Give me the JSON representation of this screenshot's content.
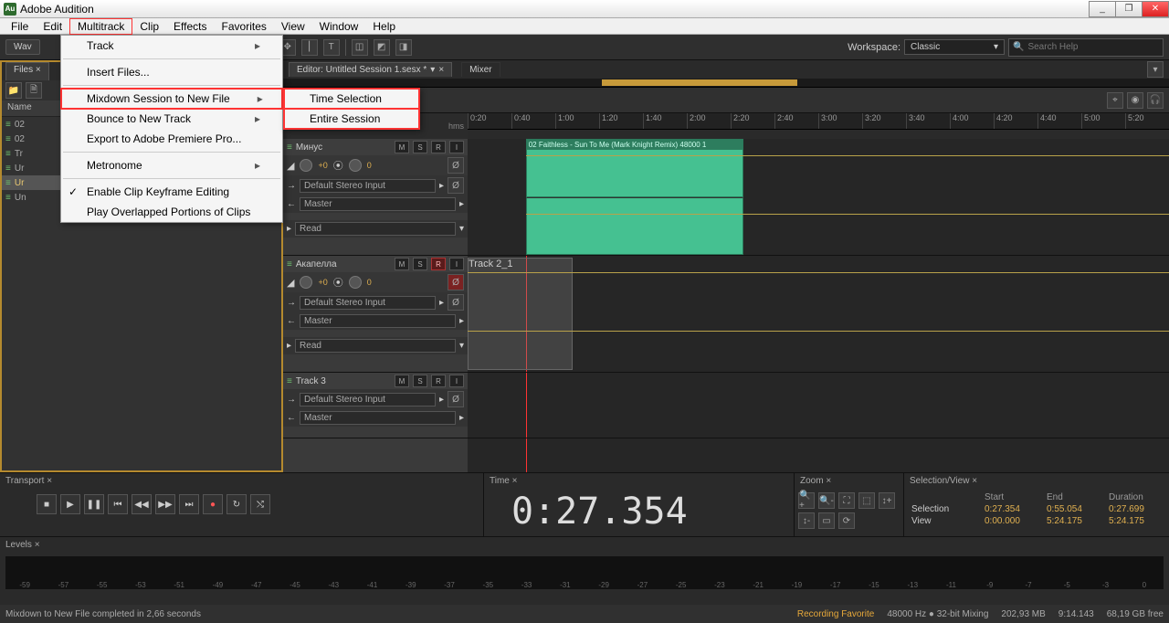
{
  "app": {
    "title": "Adobe Audition",
    "logo": "Au"
  },
  "window_buttons": {
    "min": "_",
    "max": "❐",
    "close": "✕"
  },
  "menubar": [
    "File",
    "Edit",
    "Multitrack",
    "Clip",
    "Effects",
    "Favorites",
    "View",
    "Window",
    "Help"
  ],
  "toolbar": {
    "waveform_label": "Wav",
    "workspace_label": "Workspace:",
    "workspace_value": "Classic",
    "search_placeholder": "Search Help",
    "search_icon": "🔍"
  },
  "files_panel": {
    "tab": "Files",
    "column": "Name",
    "rows": [
      "02",
      "02",
      "Tr",
      "Ur",
      "Ur",
      "Un"
    ]
  },
  "editor": {
    "tab_label": "Editor: Untitled Session 1.sesx *",
    "mixer_tab": "Mixer",
    "hms_label": "hms",
    "ruler": [
      "0:20",
      "0:40",
      "1:00",
      "1:20",
      "1:40",
      "2:00",
      "2:20",
      "2:40",
      "3:00",
      "3:20",
      "3:40",
      "4:00",
      "4:20",
      "4:40",
      "5:00",
      "5:20"
    ],
    "clip1_label": "02 Faithless - Sun To Me (Mark Knight Remix) 48000 1",
    "clip2_label": "Track 2_1",
    "tracks": [
      {
        "name": "Минус",
        "m": "M",
        "s": "S",
        "r": "R",
        "i": "I",
        "vol": "+0",
        "pan": "0",
        "input": "Default Stereo Input",
        "output": "Master",
        "read": "Read",
        "rec": false
      },
      {
        "name": "Акапелла",
        "m": "M",
        "s": "S",
        "r": "R",
        "i": "I",
        "vol": "+0",
        "pan": "0",
        "input": "Default Stereo Input",
        "output": "Master",
        "read": "Read",
        "rec": true
      },
      {
        "name": "Track 3",
        "m": "M",
        "s": "S",
        "r": "R",
        "i": "I",
        "vol": "",
        "pan": "",
        "input": "Default Stereo Input",
        "output": "Master",
        "read": "",
        "rec": false
      }
    ]
  },
  "multitrack_menu": {
    "items": [
      {
        "label": "Track",
        "sub": true
      },
      {
        "label": "Insert Files...",
        "sub": false
      },
      {
        "label": "Mixdown Session to New File",
        "sub": true,
        "hot": true
      },
      {
        "label": "Bounce to New Track",
        "sub": true
      },
      {
        "label": "Export to Adobe Premiere Pro...",
        "sub": false
      },
      {
        "label": "Metronome",
        "sub": true
      },
      {
        "label": "Enable Clip Keyframe Editing",
        "sub": false,
        "checked": true
      },
      {
        "label": "Play Overlapped Portions of Clips",
        "sub": false
      }
    ],
    "submenu": [
      "Time Selection",
      "Entire Session"
    ]
  },
  "transport": {
    "title": "Transport"
  },
  "time_panel": {
    "title": "Time",
    "value": "0:27.354"
  },
  "zoom_panel": {
    "title": "Zoom"
  },
  "selview": {
    "title": "Selection/View",
    "head": [
      "",
      "Start",
      "End",
      "Duration"
    ],
    "rows": [
      [
        "Selection",
        "0:27.354",
        "0:55.054",
        "0:27.699"
      ],
      [
        "View",
        "0:00.000",
        "5:24.175",
        "5:24.175"
      ]
    ]
  },
  "levels": {
    "title": "Levels",
    "scale": [
      "-59",
      "-57",
      "-55",
      "-53",
      "-51",
      "-49",
      "-47",
      "-45",
      "-43",
      "-41",
      "-39",
      "-37",
      "-35",
      "-33",
      "-31",
      "-29",
      "-27",
      "-25",
      "-23",
      "-21",
      "-19",
      "-17",
      "-15",
      "-13",
      "-11",
      "-9",
      "-7",
      "-5",
      "-3",
      "0"
    ]
  },
  "status": {
    "msg": "Mixdown to New File completed in 2,66 seconds",
    "fav": "Recording Favorite",
    "rate": "48000 Hz ● 32-bit Mixing",
    "mem": "202,93 MB",
    "dur": "9:14.143",
    "free": "68,19 GB free"
  }
}
